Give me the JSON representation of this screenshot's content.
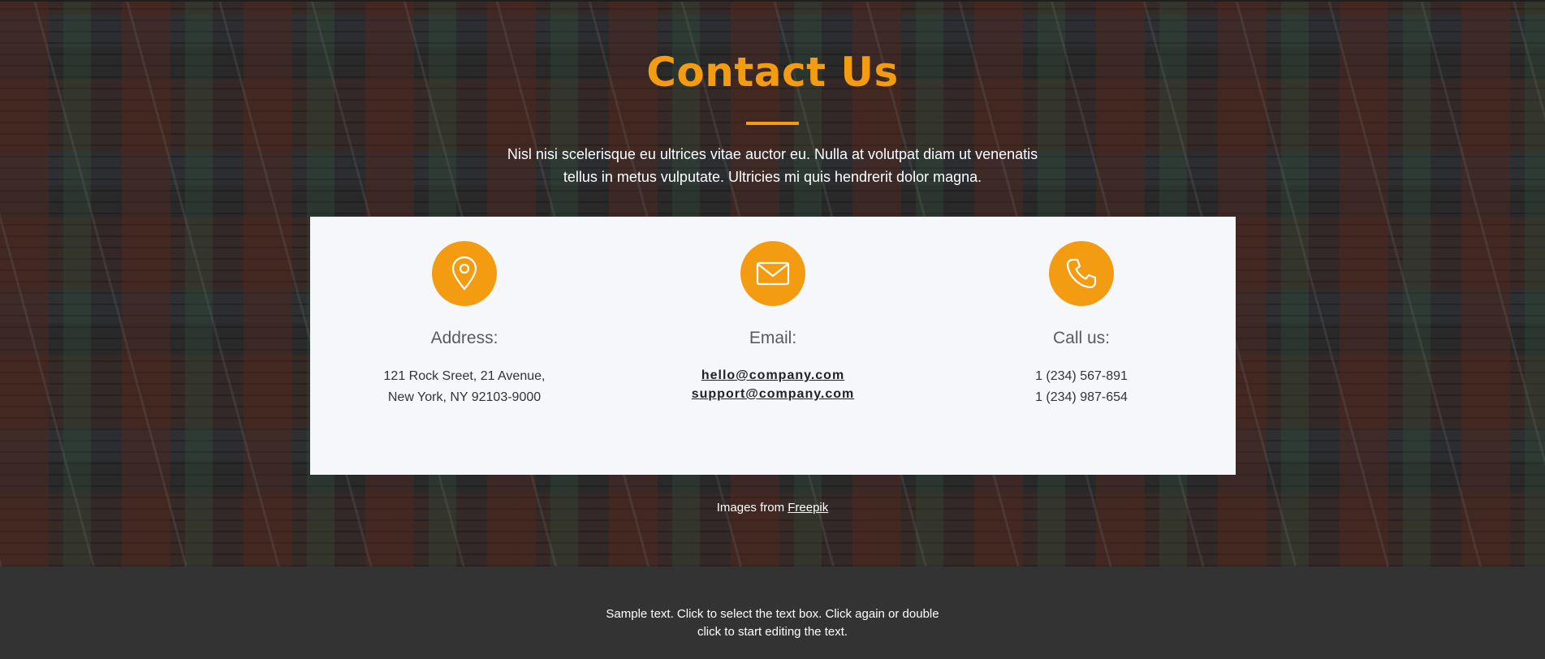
{
  "hero": {
    "title": "Contact Us",
    "intro": "Nisl nisi scelerisque eu ultrices vitae auctor eu. Nulla at volutpat diam ut venenatis tellus in metus vulputate. Ultricies mi quis hendrerit dolor magna."
  },
  "colors": {
    "accent": "#f39c12",
    "card_background": "#f6f7fa",
    "footer_background": "#333333"
  },
  "contact": {
    "address": {
      "icon": "map-pin-icon",
      "heading": "Address:",
      "lines": [
        "121 Rock Sreet, 21 Avenue,",
        "New York, NY 92103-9000"
      ]
    },
    "email": {
      "icon": "envelope-icon",
      "heading": "Email:",
      "links": [
        "hello@company.com",
        "support@company.com"
      ]
    },
    "phone": {
      "icon": "phone-icon",
      "heading": "Call us:",
      "lines": [
        "1 (234) 567-891",
        "1 (234) 987-654"
      ]
    }
  },
  "credit": {
    "prefix": "Images from",
    "link": "Freepik"
  },
  "footer": {
    "lines": [
      "Sample text. Click to select the text box. Click again or double",
      "click to start editing the text."
    ]
  }
}
